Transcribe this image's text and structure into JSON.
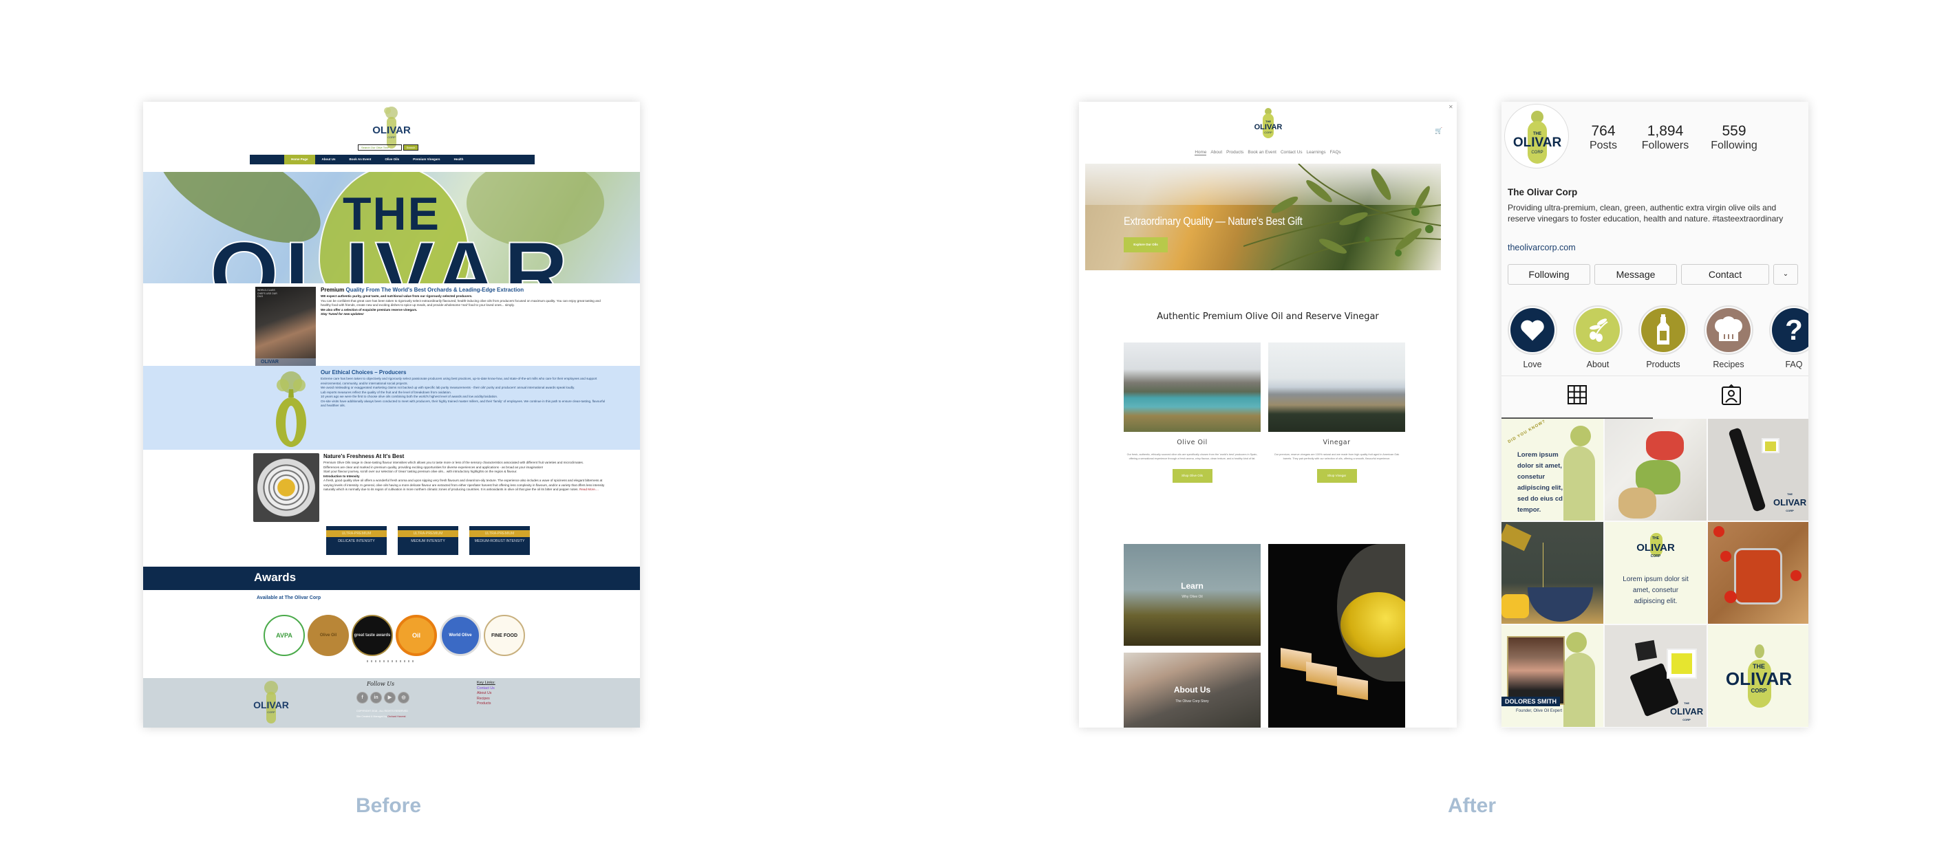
{
  "captions": {
    "before": "Before",
    "after": "After"
  },
  "colors": {
    "navy": "#0d2a4d",
    "olive_green": "#a9b533",
    "lime": "#b8c94a",
    "caption": "#a7bdd3"
  },
  "before_site": {
    "logo": {
      "brand": "OLIVAR",
      "sub": "CORP"
    },
    "search": {
      "placeholder": "Search Our Olive Tree",
      "button": "Search"
    },
    "nav": [
      "Home Page",
      "About Us",
      "Book An Event",
      "Olive Oils",
      "Premium Vinegars",
      "Health"
    ],
    "hero": {
      "line1": "THE",
      "line2": "OLIVAR"
    },
    "section1": {
      "image_caption": "WORLD-CLASS CHEFS USE OUR OILS",
      "image_brand": "OLIVAR",
      "title_plain": "Premium ",
      "title_blue": "Quality From The World's Best Orchards & Leading-Edge Extraction",
      "lead": "WE expect authentic purity, great taste, and nutritional value from our rigorously selected producers.",
      "body": "You can be confident that great care has been taken to rigorously select extraordinarily flavoured, health-inducing olive oils from producers focused on maximum quality.  You can enjoy great tasting and healthy food with friends, create new and exciting dishes to spice up meals, and provide wholesome 'real' food to your loved ones... simply.",
      "bold_line": "We also offer a selection of exquisite premium reserve vinegars.",
      "italic_line": "Stay Tuned for new updates!"
    },
    "section2": {
      "title": "Our Ethical Choices – Producers",
      "paragraphs": [
        "Extreme care has been taken to objectively and rigorously select passionate producers using best practices, up-to-date know-how, and state-of-the-art mills who care for their employees and support environmental, community, and/or international social projects.",
        "We avoid misleading or exaggerated marketing claims not backed up with specific lab purity measurements  - their oils' purity and producers' annual international awards speak loudly.",
        "Lab reports measures reflect the quality of the fruit and the level of breakdown from oxidation.",
        "10 years ago we were the first to choose olive oils combining both the world's highest level of awards and low acidity/oxidation.",
        "On-site visits have additionally always been conducted to meet with producers, their highly trained master millers, and their 'family' of employees.  We continue in this path to ensure clean-tasting, flavourful and healthier oils."
      ]
    },
    "section3": {
      "title": "Nature's Freshness At It's Best",
      "paragraphs": [
        "Premium Olive Oils range in clean-tasting flavour intensities which allows you to taste more or less of the sensory characteristics associated with different fruit varieties and microclimates.",
        "Differences are clear and marked in premium quality, providing exciting opportunities for diverse experiences and applications - as broad as your imagination!",
        "Start your flavour journey, scroll over our selection of  'clean' tasting premium olive oils... with introductory highlights on the region & flavour."
      ],
      "subhead": "Introduction to Intensity",
      "intensity_text": "A fresh, good quality olive oil offers a wonderful fresh aroma and upon sipping very fresh flavours and clean/non-oily texture.  The experience also includes a wave of spiciness and elegant bitterness at varying levels of intensity.  In general, olive oils having a more delicate flavour are extracted from either riper/later harvest fruit offering less complexity in flavours, and/or a variety that offers less intensity naturally which is normally due to its region of cultivation in more northern climatic zones of producing countries. It is antioxidants in olive oil that give the oil its bitter and pepper notes.",
      "read_more": "Read More....",
      "tiers": [
        {
          "top": "ULTRA-PREMIUM",
          "bottom": "DELICATE INTENSITY"
        },
        {
          "top": "ULTRA-PREMIUM",
          "bottom": "MEDIUM INTENSITY"
        },
        {
          "top": "ULTRA-PREMIUM",
          "bottom": "MEDIUM-ROBUST INTENSITY"
        }
      ]
    },
    "awards": {
      "title": "Awards",
      "available": "Available at The Olivar Corp",
      "badges": [
        "AVPA",
        "Olive Oil",
        "great taste awards",
        "Oil",
        "World Olive",
        "FINE FOOD"
      ]
    },
    "footer": {
      "follow": "Follow Us",
      "social": [
        "facebook",
        "linkedin",
        "youtube",
        "instagram"
      ],
      "copyright": "COPYRIGHT 2018 - ALL RIGHTS RESERVED",
      "credit_prefix": "Site Created & Managed by ",
      "credit_link": "Orchard Harvest",
      "key_links_title": "Key Links:",
      "key_links": [
        "Contact Us",
        "About Us",
        "Recipes",
        "Products"
      ]
    }
  },
  "after_site": {
    "logo": {
      "the": "THE",
      "brand": "OLIVAR",
      "corp": "CORP"
    },
    "nav": [
      "Home",
      "About",
      "Products",
      "Book an Event",
      "Contact Us",
      "Learnings",
      "FAQs"
    ],
    "active_nav": "Home",
    "hero": {
      "title": "Extraordinary Quality — Nature's Best Gift",
      "button": "Explore Our Oils"
    },
    "heading": "Authentic Premium Olive Oil and Reserve Vinegar",
    "cards": [
      {
        "title": "Olive Oil",
        "desc": "Our fresh, authentic, ethically sourced olive oils are specifically chosen from the 'world's best' producers in Spain, offering a sensational experience through a fresh aroma, crisp flavour, clean texture, and a healthy kind of fat.",
        "button": "Shop Olive Oils"
      },
      {
        "title": "Vinegar",
        "desc": "Our premium, reserve vinegars are 100% natural and are made from high quality fruit aged in American Oak barrels. They pair perfectly with our selection of oils, offering a smooth, flavourful experience.",
        "button": "Shop Vinegar"
      }
    ],
    "tiles": [
      {
        "title": "Learn",
        "sub": "Why Olive Oil"
      },
      {
        "title": "About Us",
        "sub": "The Olivar Corp Story"
      }
    ]
  },
  "instagram": {
    "stats": [
      {
        "value": "764",
        "label": "Posts"
      },
      {
        "value": "1,894",
        "label": "Followers"
      },
      {
        "value": "559",
        "label": "Following"
      }
    ],
    "name": "The Olivar Corp",
    "bio": "Providing ultra-premium, clean, green, authentic extra virgin olive oils and reserve vinegars to foster education, health and nature. #tasteextraordinary",
    "link": "theolivarcorp.com",
    "buttons": [
      "Following",
      "Message",
      "Contact"
    ],
    "highlights": [
      {
        "label": "Love",
        "icon": "heart-icon",
        "color": "#0d2a4d"
      },
      {
        "label": "About",
        "icon": "olive-branch-icon",
        "color": "#c5cf5c"
      },
      {
        "label": "Products",
        "icon": "bottle-icon",
        "color": "#a39628"
      },
      {
        "label": "Recipes",
        "icon": "chef-hat-icon",
        "color": "#9a7b6c"
      },
      {
        "label": "FAQ",
        "icon": "question-icon",
        "color": "#0d2a4d"
      }
    ],
    "posts": {
      "did_you_know": "DID YOU KNOW?",
      "lorem1": "Lorem ipsum dolor sit amet, consetur adipiscing elit, sed do eius cd tempor.",
      "lorem2": "Lorem ipsum dolor sit amet, consetur adipiscing elit.",
      "founder_name": "DOLORES SMITH",
      "founder_title": "Founder, Olive Oil Expert",
      "brand_the": "THE",
      "brand_name": "OLIVAR",
      "brand_corp": "CORP"
    }
  }
}
